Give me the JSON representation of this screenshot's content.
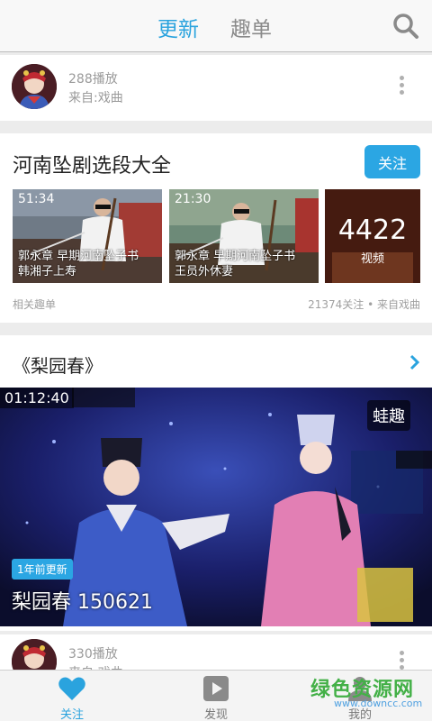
{
  "header": {
    "tabs": [
      {
        "label": "更新",
        "active": true
      },
      {
        "label": "趣单",
        "active": false
      }
    ],
    "search_icon": "search-icon",
    "accent_color": "#2aa3de"
  },
  "feed": [
    {
      "type": "author",
      "plays": "288播放",
      "source": "来自:戏曲"
    },
    {
      "type": "playlist",
      "title": "河南坠剧选段大全",
      "follow_label": "关注",
      "thumbnails": [
        {
          "duration": "51:34",
          "caption_line1": "郭永章 早期河南坠子书",
          "caption_line2": "韩湘子上寿"
        },
        {
          "duration": "21:30",
          "caption_line1": "郭永章 早期河南坠子书",
          "caption_line2": "王员外休妻"
        },
        {
          "count": "4422",
          "count_label": "视频"
        }
      ],
      "footer_left": "相关趣单",
      "footer_right": "21374关注 • 来自戏曲"
    },
    {
      "type": "video",
      "title": "《梨园春》",
      "duration": "01:12:40",
      "source_badge": "蛙趣",
      "update_badge": "1年前更新",
      "video_title": "梨园春 150621"
    },
    {
      "type": "author",
      "plays": "330播放",
      "source": "来自:戏曲"
    }
  ],
  "bottom_nav": [
    {
      "label": "关注",
      "icon": "heart-icon",
      "active": true
    },
    {
      "label": "发现",
      "icon": "play-icon",
      "active": false
    },
    {
      "label": "我的",
      "icon": "person-icon",
      "active": false
    }
  ],
  "watermark": {
    "text": "绿色资源网",
    "url": "www.downcc.com"
  }
}
